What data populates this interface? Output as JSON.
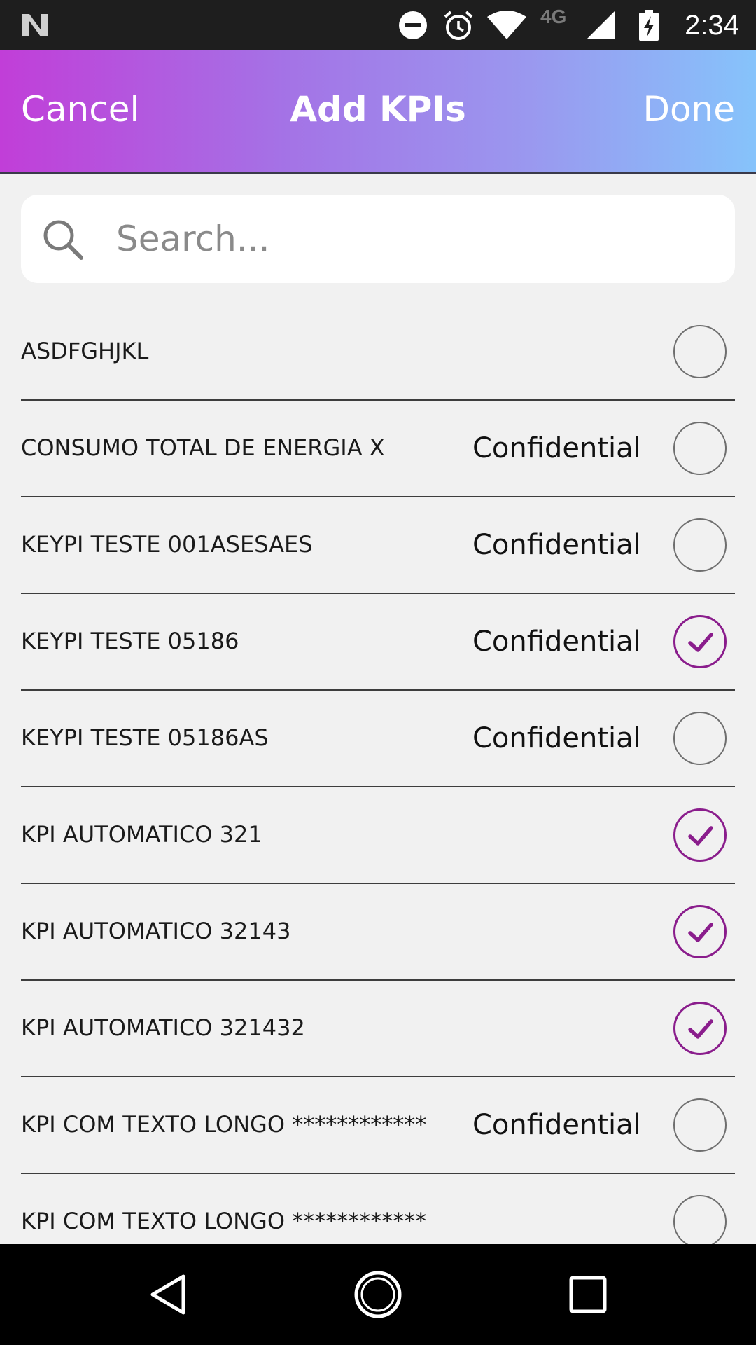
{
  "status_bar": {
    "time": "2:34",
    "network": "4G",
    "icons": [
      "notification-n-icon",
      "do-not-disturb-icon",
      "alarm-icon",
      "wifi-icon",
      "cell-signal-icon",
      "battery-charging-icon"
    ]
  },
  "header": {
    "cancel_label": "Cancel",
    "title": "Add KPIs",
    "done_label": "Done"
  },
  "search": {
    "placeholder": "Search...",
    "value": ""
  },
  "kpis": [
    {
      "name": "ASDFGHJKL",
      "badge": "",
      "selected": false
    },
    {
      "name": "CONSUMO TOTAL DE ENERGIA X",
      "badge": "Confidential",
      "selected": false
    },
    {
      "name": "KEYPI TESTE 001ASESAES",
      "badge": "Confidential",
      "selected": false
    },
    {
      "name": "KEYPI TESTE 05186",
      "badge": "Confidential",
      "selected": true
    },
    {
      "name": "KEYPI TESTE 05186AS",
      "badge": "Confidential",
      "selected": false
    },
    {
      "name": "KPI AUTOMATICO 321",
      "badge": "",
      "selected": true
    },
    {
      "name": "KPI AUTOMATICO 32143",
      "badge": "",
      "selected": true
    },
    {
      "name": "KPI AUTOMATICO 321432",
      "badge": "",
      "selected": true
    },
    {
      "name": "KPI COM TEXTO LONGO ************",
      "badge": "Confidential",
      "selected": false
    },
    {
      "name": "KPI COM TEXTO LONGO ************",
      "badge": "",
      "selected": false
    }
  ],
  "colors": {
    "accent": "#8a1d8c",
    "header_gradient_start": "#c13ed8",
    "header_gradient_end": "#86c3fb",
    "background": "#f1f1f1"
  },
  "nav": {
    "icons": [
      "back-icon",
      "home-icon",
      "recents-icon"
    ]
  }
}
